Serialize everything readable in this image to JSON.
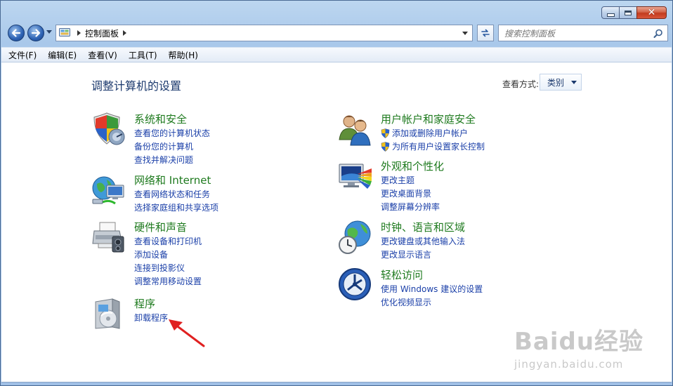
{
  "window": {
    "caption": {
      "minimize": "minimize",
      "maximize": "maximize",
      "close": "close"
    }
  },
  "nav": {
    "breadcrumb": [
      "控制面板"
    ],
    "search_placeholder": "搜索控制面板"
  },
  "menu": [
    "文件(F)",
    "编辑(E)",
    "查看(V)",
    "工具(T)",
    "帮助(H)"
  ],
  "main": {
    "title": "调整计算机的设置",
    "view_by_label": "查看方式:",
    "view_by_value": "类别",
    "categories": [
      {
        "title": "系统和安全",
        "icon": "shield-icon",
        "links": [
          "查看您的计算机状态",
          "备份您的计算机",
          "查找并解决问题"
        ]
      },
      {
        "title": "网络和 Internet",
        "icon": "network-globe-icon",
        "links": [
          "查看网络状态和任务",
          "选择家庭组和共享选项"
        ]
      },
      {
        "title": "硬件和声音",
        "icon": "printer-icon",
        "links": [
          "查看设备和打印机",
          "添加设备",
          "连接到投影仪",
          "调整常用移动设置"
        ]
      },
      {
        "title": "程序",
        "icon": "program-box-icon",
        "links": [
          "卸载程序"
        ]
      },
      {
        "title": "用户帐户和家庭安全",
        "icon": "users-icon",
        "links": [
          "添加或删除用户帐户",
          "为所有用户设置家长控制"
        ]
      },
      {
        "title": "外观和个性化",
        "icon": "monitor-palette-icon",
        "links": [
          "更改主题",
          "更改桌面背景",
          "调整屏幕分辨率"
        ]
      },
      {
        "title": "时钟、语言和区域",
        "icon": "clock-globe-icon",
        "links": [
          "更改键盘或其他输入法",
          "更改显示语言"
        ]
      },
      {
        "title": "轻松访问",
        "icon": "ease-of-access-icon",
        "links": [
          "使用 Windows 建议的设置",
          "优化视频显示"
        ]
      }
    ]
  },
  "watermark": {
    "brand": "Baidu经验",
    "url": "jingyan.baidu.com"
  },
  "colors": {
    "category_title": "#1e7a1e",
    "link": "#1a3fa8",
    "page_title": "#1c3a6e",
    "annotation_arrow": "#e02020"
  }
}
